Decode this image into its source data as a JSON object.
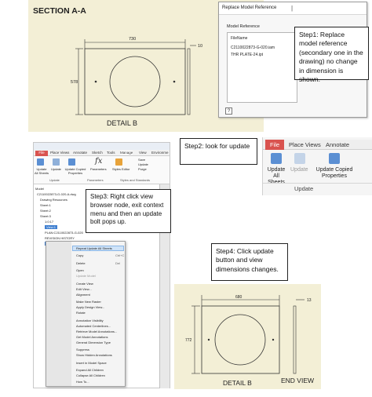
{
  "top_drawing": {
    "section_title": "SECTION A-A",
    "width_dim": "730",
    "side_dim": "10",
    "height_dim": "578",
    "view_label": "DETAIL B"
  },
  "replace_dialog": {
    "title": "Replace Model Reference",
    "group_label": "Model Reference",
    "column_header": "FileName",
    "files": [
      "C2110022873-G-020.iam",
      "THR PLATE-24.ipt"
    ]
  },
  "callouts": {
    "step1": "Step1: Replace model reference (secondary one in the drawing) no change in dimension is shown.",
    "step2": "Step2: look for update",
    "step3": "Step3: Right click view browser node, exit context menu and then an update bolt pops up.",
    "step4": "Step4: Click update button and view dimensions changes."
  },
  "small_ribbon": {
    "tabs": [
      "File",
      "Place Views",
      "Annotate",
      "Sketch",
      "Tools",
      "Manage",
      "View",
      "Environme"
    ],
    "buttons": [
      "Update All Sheets",
      "Update",
      "Update Copied Properties",
      "Parameters",
      "Styles Editor",
      "Save",
      "Update",
      "Purge"
    ],
    "groups": [
      "Update",
      "Parameters",
      "Styles and Standards"
    ],
    "browser_label": "Model",
    "tree": [
      "C2110022873-G-020-A.dwg",
      "Drawing Resources",
      "Sheet:1",
      "Sheet:2",
      "Sheet:3",
      "1:0:17",
      "View:1",
      "PLAN:C2110022873-G-020",
      "REVISION HISTORY",
      "TITLE BLOCK"
    ]
  },
  "big_ribbon": {
    "tabs": [
      "File",
      "Place Views",
      "Annotate"
    ],
    "buttons": [
      "Update All Sheets",
      "Update",
      "Update Copied Properties"
    ],
    "group_label": "Update"
  },
  "context_menu": {
    "items": [
      "Repeat Update All Sheets",
      "Copy",
      "Delete",
      "Open",
      "Update Model",
      "Create View",
      "Edit View...",
      "Alignment",
      "Make New Raster",
      "Apply Design View...",
      "Rotate",
      "Annotation Visibility",
      "Automated Centerlines...",
      "Retrieve Model Annotations...",
      "Get Model Annotations",
      "General Dimension Type",
      "Suppress",
      "Show Hidden Annotations",
      "Insert in Model Space",
      "Expand All Children",
      "Collapse All Children",
      "How To..."
    ],
    "shortcut_copy": "Ctrl+C",
    "shortcut_delete": "Del"
  },
  "bottom_drawing": {
    "width_dim": "680",
    "side_dim": "13",
    "height_dim": "772",
    "view_label": "DETAIL B",
    "end_view_label": "END VIEW"
  },
  "colors": {
    "paper": "#f3efd6",
    "file_tab": "#d9534f",
    "selection": "#3f7fd0"
  }
}
